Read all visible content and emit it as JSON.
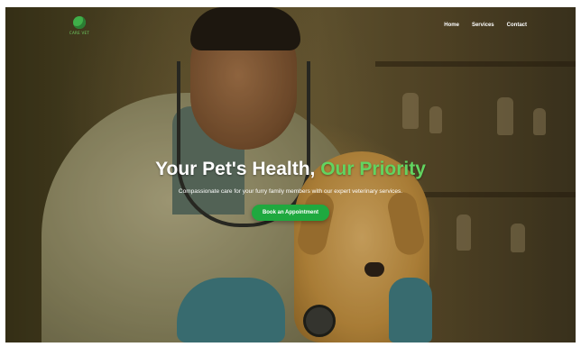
{
  "brand": {
    "name": "CARE VET",
    "logo_icon": "paw-heart-icon",
    "accent": "#3fae49"
  },
  "nav": {
    "items": [
      "Home",
      "Services",
      "Contact"
    ]
  },
  "hero": {
    "title_main": "Your Pet's Health, ",
    "title_accent": "Our Priority",
    "subtitle": "Compassionate care for your furry family members with our expert veterinary services.",
    "cta_label": "Book an Appointment",
    "accent_color": "#62d460",
    "button_color": "#1fa93f"
  }
}
